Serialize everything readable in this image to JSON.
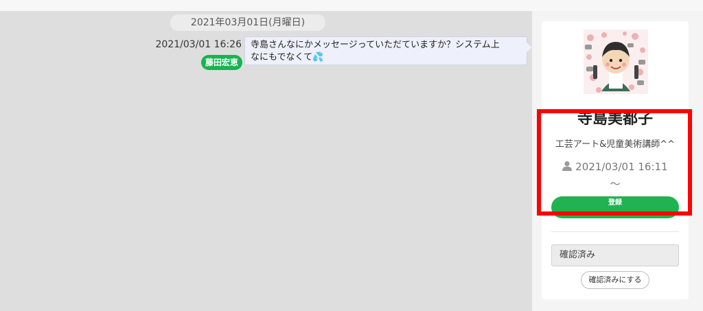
{
  "chat": {
    "date_separator": "2021年03月01日(月曜日)",
    "messages": [
      {
        "time": "2021/03/01 16:26",
        "sender": "藤田宏恵",
        "text_line1": "寺島さんなにかメッセージっていただていますか？システム上",
        "text_line2": "なにもでなくて",
        "emoji": "💦"
      }
    ]
  },
  "profile": {
    "name": "寺島美都子",
    "description": "工芸アート&児童美術講師^^",
    "since": "2021/03/01 16:11",
    "since_suffix": "〜",
    "action_button_label": "登録",
    "confirm_status": "確認済み",
    "confirm_button_label": "確認済みにする"
  },
  "colors": {
    "accent_green": "#1fb351",
    "highlight_red": "#ff0000",
    "chat_background": "#dedede"
  }
}
